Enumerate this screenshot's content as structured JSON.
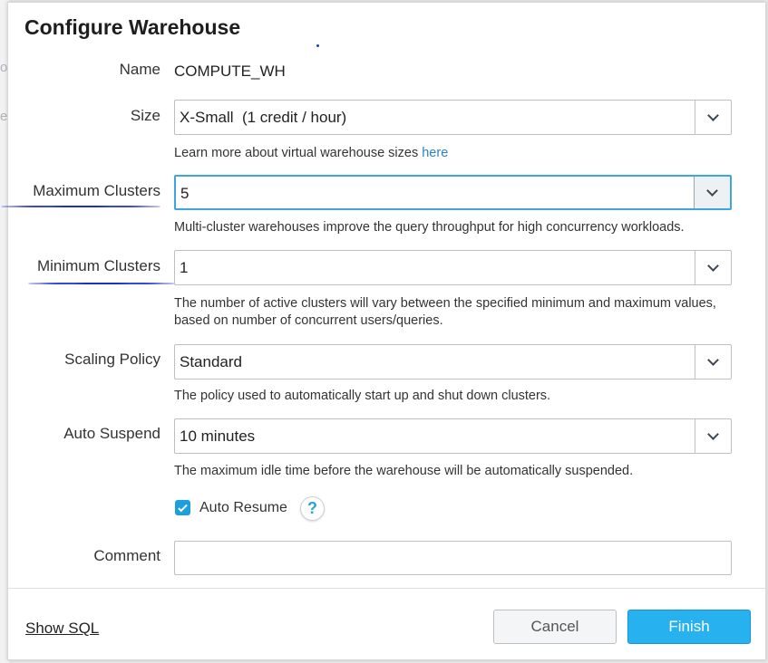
{
  "dialog": {
    "title": "Configure Warehouse"
  },
  "fields": {
    "name": {
      "label": "Name",
      "value": "COMPUTE_WH"
    },
    "size": {
      "label": "Size",
      "value": "X-Small  (1 credit / hour)",
      "help": "Learn more about virtual warehouse sizes ",
      "help_link": "here"
    },
    "max_clusters": {
      "label": "Maximum Clusters",
      "value": "5",
      "help": "Multi-cluster warehouses improve the query throughput for high concurrency workloads."
    },
    "min_clusters": {
      "label": "Minimum Clusters",
      "value": "1",
      "help": "The number of active clusters will vary between the specified minimum and maximum values, based on number of concurrent users/queries."
    },
    "scaling_policy": {
      "label": "Scaling Policy",
      "value": "Standard",
      "help": "The policy used to automatically start up and shut down clusters."
    },
    "auto_suspend": {
      "label": "Auto Suspend",
      "value": "10 minutes",
      "help": "The maximum idle time before the warehouse will be automatically suspended."
    },
    "auto_resume": {
      "label": "Auto Resume",
      "checked": true,
      "help_icon": "?"
    },
    "comment": {
      "label": "Comment",
      "value": ""
    }
  },
  "footer": {
    "show_sql": "Show SQL",
    "cancel": "Cancel",
    "finish": "Finish"
  },
  "colors": {
    "accent": "#27b2ef",
    "annotation": "#1d2fc9",
    "link": "#2c7fc7"
  },
  "icons": {
    "dropdown": "chevron-down-icon",
    "checkbox": "checkmark-icon",
    "help": "question-mark-icon"
  }
}
